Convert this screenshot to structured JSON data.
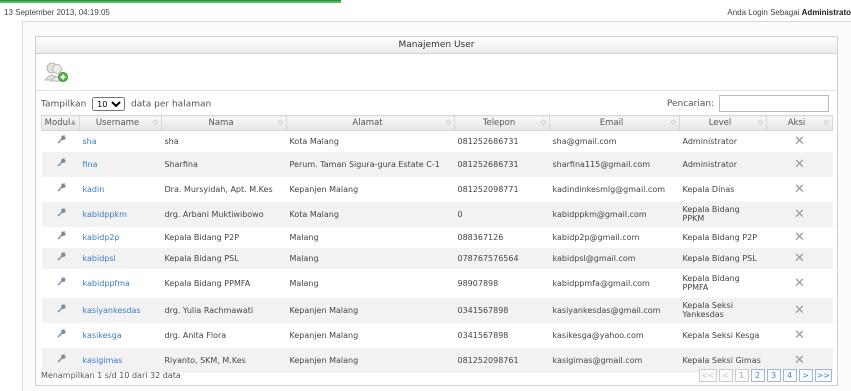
{
  "header": {
    "timestamp": "13 September 2013, 04:19:05",
    "login_prefix": "Anda Login Sebagai",
    "login_role": "Administrato"
  },
  "panel": {
    "title": "Manajemen User",
    "add_icon": "add-user-icon"
  },
  "controls": {
    "show_label": "Tampilkan",
    "page_size": "10",
    "per_page_label": "data per halaman",
    "search_label": "Pencarian:",
    "search_value": ""
  },
  "table": {
    "columns": [
      "Modul",
      "Username",
      "Nama",
      "Alamat",
      "Telepon",
      "Email",
      "Level",
      "Aksi"
    ],
    "rows": [
      {
        "username": "sha",
        "nama": "sha",
        "alamat": "Kota Malang",
        "telepon": "081252686731",
        "email": "sha@gmail.com",
        "level": "Administrator"
      },
      {
        "username": "fina",
        "nama": "Sharfina",
        "alamat": "Perum. Taman Sigura-gura Estate C-1",
        "telepon": "081252686731",
        "email": "sharfina115@gmail.com",
        "level": "Administrator"
      },
      {
        "username": "kadin",
        "nama": "Dra. Mursyidah, Apt. M.Kes",
        "alamat": "Kepanjen Malang",
        "telepon": "081252098771",
        "email": "kadindinkesmlg@gmail.com",
        "level": "Kepala Dinas"
      },
      {
        "username": "kabidppkm",
        "nama": "drg. Arbani Muktiwibowo",
        "alamat": "Kota Malang",
        "telepon": "0",
        "email": "kabidppkm@gmail.com",
        "level": "Kepala Bidang PPKM"
      },
      {
        "username": "kabidp2p",
        "nama": "Kepala Bidang P2P",
        "alamat": "Malang",
        "telepon": "088367126",
        "email": "kabidp2p@gmail.com",
        "level": "Kepala Bidang P2P"
      },
      {
        "username": "kabidpsl",
        "nama": "Kepala Bidang PSL",
        "alamat": "Malang",
        "telepon": "078767576564",
        "email": "kabidpsl@gmail.com",
        "level": "Kepala Bidang PSL"
      },
      {
        "username": "kabidppfma",
        "nama": "Kepala Bidang PPMFA",
        "alamat": "Malang",
        "telepon": "98907898",
        "email": "kabidppmfa@gmail.com",
        "level": "Kepala Bidang PPMFA"
      },
      {
        "username": "kasiyankesdas",
        "nama": "drg. Yulia Rachmawati",
        "alamat": "Kepanjen Malang",
        "telepon": "0341567898",
        "email": "kasiyankesdas@gmail.com",
        "level": "Kepala Seksi Yankesdas"
      },
      {
        "username": "kasikesga",
        "nama": "drg. Anita Flora",
        "alamat": "Kepanjen Malang",
        "telepon": "0341567898",
        "email": "kasikesga@yahoo.com",
        "level": "Kepala Seksi Kesga"
      },
      {
        "username": "kasigimas",
        "nama": "Riyanto, SKM, M.Kes",
        "alamat": "Kepanjen Malang",
        "telepon": "081252098761",
        "email": "kasigimas@gmail.com",
        "level": "Kepala Seksi Gimas"
      }
    ],
    "action_icon": "delete-x-icon",
    "module_icon": "wrench-icon"
  },
  "footer": {
    "info": "Menampilkan 1 s/d 10 dari 32 data",
    "pager": [
      "<<",
      "<",
      "1",
      "2",
      "3",
      "4",
      ">",
      ">>"
    ]
  },
  "colors": {
    "accent_green": "#4fbf62",
    "link_blue": "#3b7cc4"
  }
}
